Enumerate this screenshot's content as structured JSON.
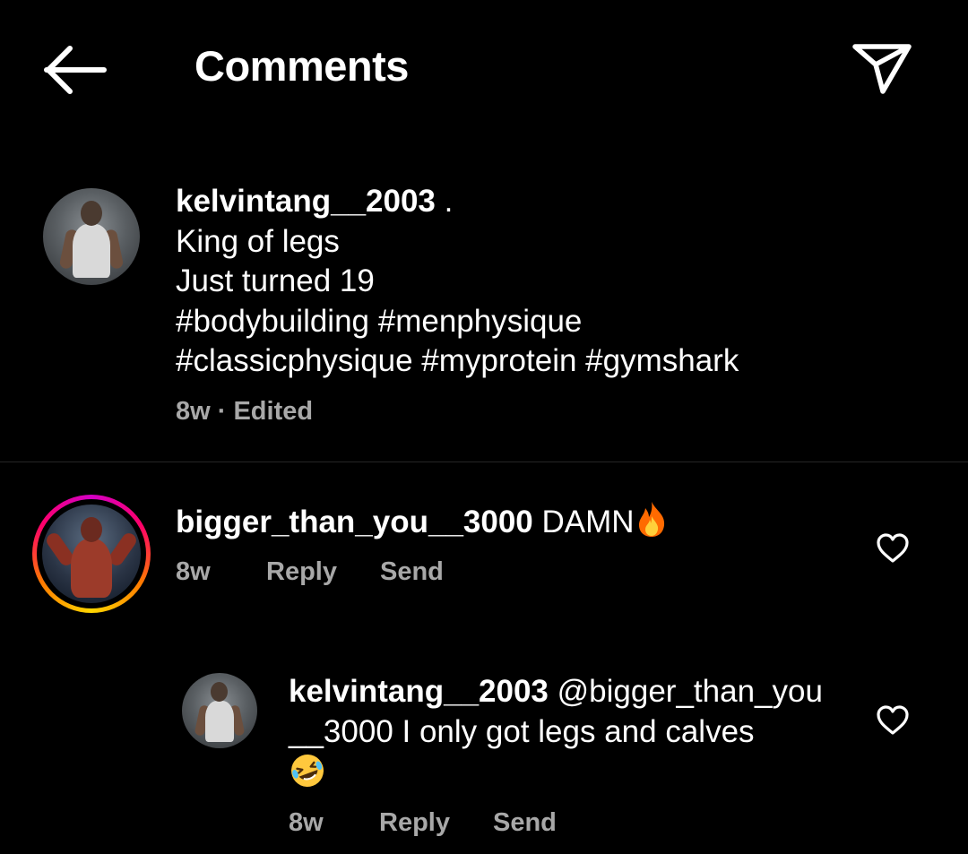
{
  "header": {
    "title": "Comments",
    "back_icon": "arrow-left-icon",
    "share_icon": "paper-plane-icon"
  },
  "caption": {
    "username": "kelvintang__2003",
    "suffix": " .",
    "lines": [
      "King of legs",
      "Just turned 19",
      "#bodybuilding #menphysique",
      "#classicphysique #myprotein #gymshark"
    ],
    "time": "8w",
    "separator": " · ",
    "edited": "Edited"
  },
  "comments": [
    {
      "username": "bigger_than_you__3000",
      "text": " DAMN",
      "emoji": "fire",
      "time": "8w",
      "reply_label": "Reply",
      "send_label": "Send",
      "has_story_ring": true
    },
    {
      "username": "kelvintang__2003",
      "mention_line1": " @bigger_than_you",
      "line2": "__3000 I only got legs and calves",
      "emoji": "rolling-on-floor-laughing",
      "time": "8w",
      "reply_label": "Reply",
      "send_label": "Send",
      "has_story_ring": false
    }
  ],
  "colors": {
    "background": "#000000",
    "text": "#ffffff",
    "secondary_text": "#a8a8a8",
    "divider": "#262626"
  }
}
